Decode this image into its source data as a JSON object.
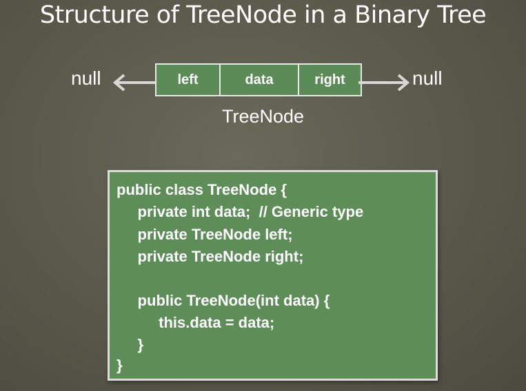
{
  "title": "Structure of TreeNode in a Binary Tree",
  "diagram": {
    "null_left": "null",
    "null_right": "null",
    "cells": {
      "left": "left",
      "data": "data",
      "right": "right"
    },
    "caption": "TreeNode",
    "colors": {
      "box_fill": "#5b8c57",
      "box_border": "#e8e8e8",
      "arrow": "#d8d8d8",
      "background": "#5c5c4e"
    }
  },
  "code": {
    "lines": [
      "public class TreeNode {",
      "     private int data;  // Generic type",
      "     private TreeNode left;",
      "     private TreeNode right;",
      "",
      "     public TreeNode(int data) {",
      "          this.data = data;",
      "     }",
      "}"
    ]
  }
}
